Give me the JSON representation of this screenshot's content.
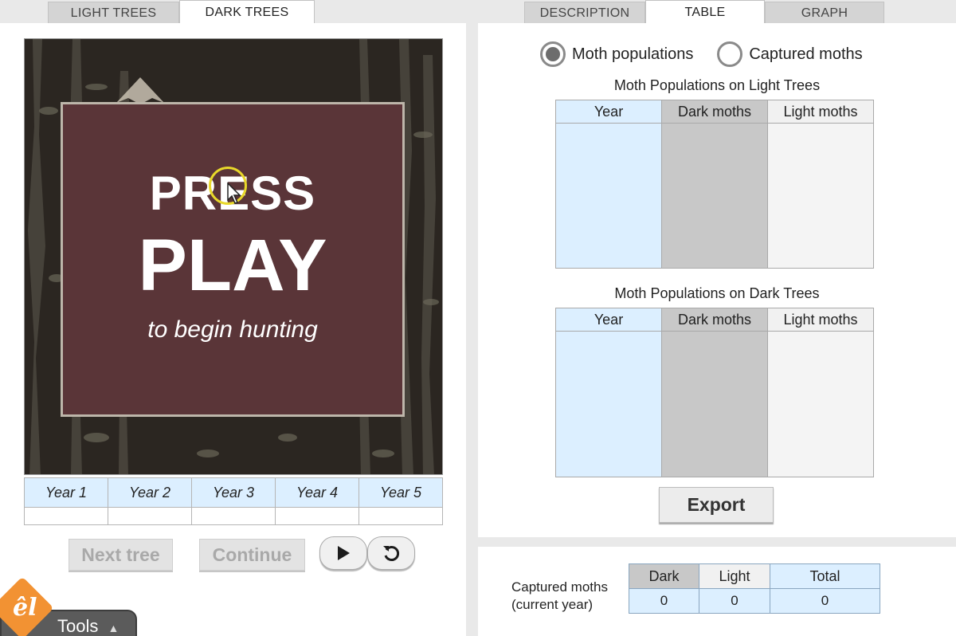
{
  "left_tabs": [
    "LIGHT TREES",
    "DARK TREES"
  ],
  "right_tabs": [
    "DESCRIPTION",
    "TABLE",
    "GRAPH"
  ],
  "overlay": {
    "line1": "PRESS",
    "line2": "PLAY",
    "line3": "to begin hunting"
  },
  "years": [
    "Year 1",
    "Year 2",
    "Year 3",
    "Year 4",
    "Year 5"
  ],
  "buttons": {
    "next_tree": "Next tree",
    "continue": "Continue",
    "export": "Export"
  },
  "tools_label": "Tools",
  "radios": {
    "option1": "Moth populations",
    "option2": "Captured moths"
  },
  "tables": {
    "light": {
      "title": "Moth Populations on Light Trees",
      "headers": [
        "Year",
        "Dark moths",
        "Light moths"
      ]
    },
    "dark": {
      "title": "Moth Populations on Dark Trees",
      "headers": [
        "Year",
        "Dark moths",
        "Light moths"
      ]
    }
  },
  "captured": {
    "label_line1": "Captured moths",
    "label_line2": "(current year)",
    "headers": [
      "Dark",
      "Light",
      "Total"
    ],
    "values": [
      "0",
      "0",
      "0"
    ]
  },
  "colors": {
    "overlay": "#5a3538",
    "year_cell": "#dcefff",
    "logo": "#f29233"
  },
  "icons": [
    "play-icon",
    "reset-icon",
    "chevron-up-icon",
    "cursor-icon"
  ]
}
